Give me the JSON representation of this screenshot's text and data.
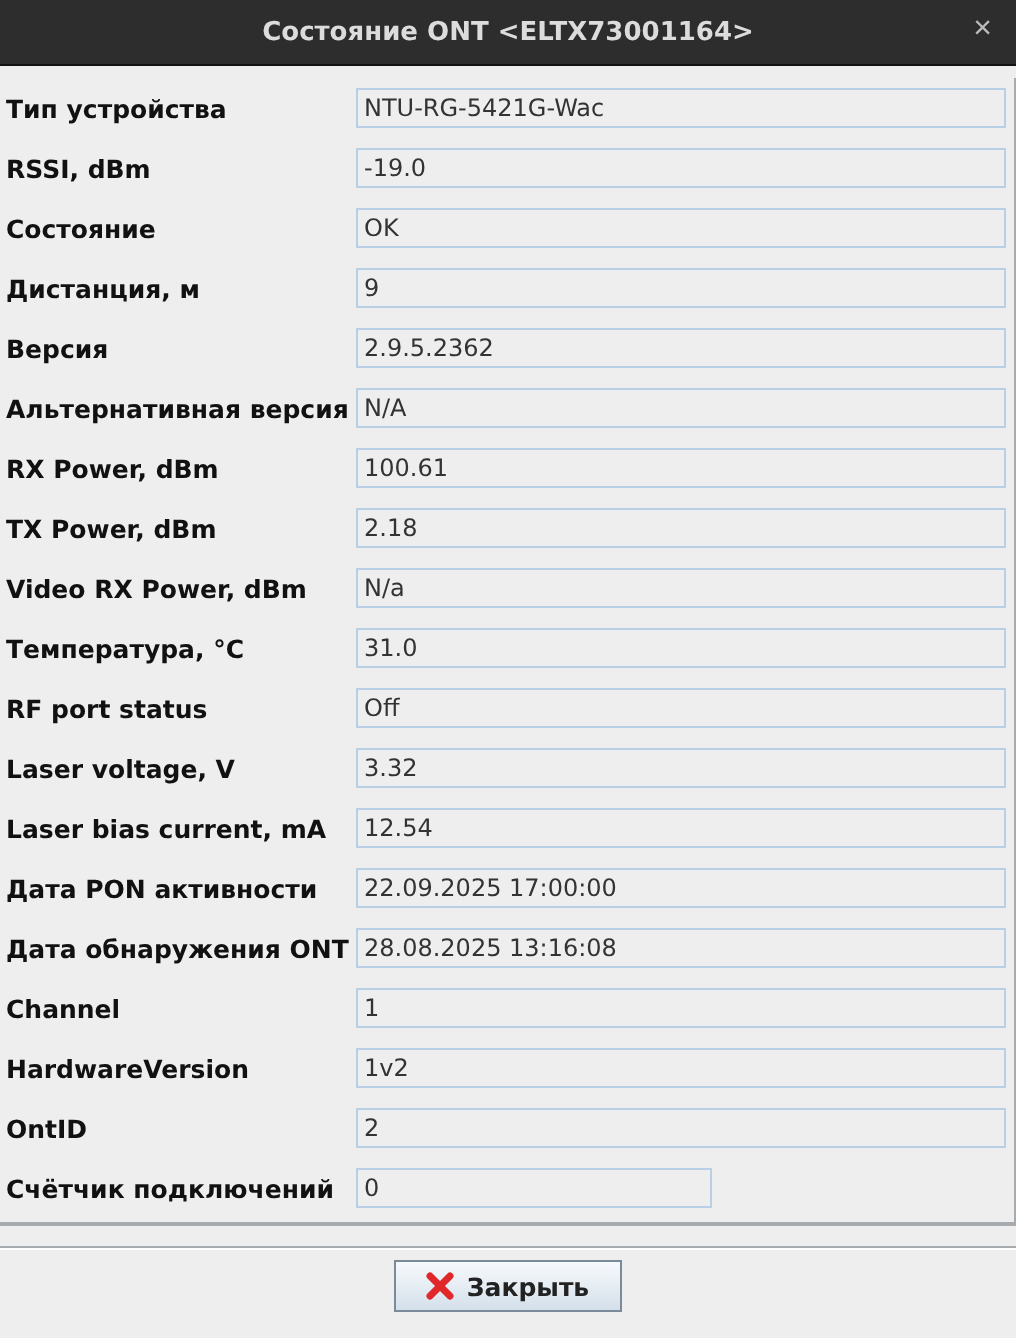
{
  "window": {
    "title": "Состояние ONT <ELTX73001164>",
    "close": "×"
  },
  "rows": [
    {
      "label": "Тип устройства",
      "value": "NTU-RG-5421G-Wac",
      "narrow": false
    },
    {
      "label": "RSSI, dBm",
      "value": "-19.0",
      "narrow": false
    },
    {
      "label": "Состояние",
      "value": "OK",
      "narrow": false
    },
    {
      "label": "Дистанция, м",
      "value": "9",
      "narrow": false
    },
    {
      "label": "Версия",
      "value": "2.9.5.2362",
      "narrow": false
    },
    {
      "label": "Альтернативная версия",
      "value": "N/A",
      "narrow": false
    },
    {
      "label": "RX Power, dBm",
      "value": "100.61",
      "narrow": false
    },
    {
      "label": "TX Power, dBm",
      "value": "2.18",
      "narrow": false
    },
    {
      "label": "Video RX Power, dBm",
      "value": "N/a",
      "narrow": false
    },
    {
      "label": "Температура, °C",
      "value": "31.0",
      "narrow": false
    },
    {
      "label": "RF port status",
      "value": "Off",
      "narrow": false
    },
    {
      "label": "Laser voltage, V",
      "value": "3.32",
      "narrow": false
    },
    {
      "label": "Laser bias current, mA",
      "value": "12.54",
      "narrow": false
    },
    {
      "label": "Дата PON активности",
      "value": "22.09.2025 17:00:00",
      "narrow": false
    },
    {
      "label": "Дата обнаружения ONT",
      "value": "28.08.2025 13:16:08",
      "narrow": false
    },
    {
      "label": "Channel",
      "value": "1",
      "narrow": false
    },
    {
      "label": "HardwareVersion",
      "value": "1v2",
      "narrow": false
    },
    {
      "label": "OntID",
      "value": "2",
      "narrow": false
    },
    {
      "label": "Счётчик подключений",
      "value": "0",
      "narrow": true
    }
  ],
  "close_button": "Закрыть"
}
